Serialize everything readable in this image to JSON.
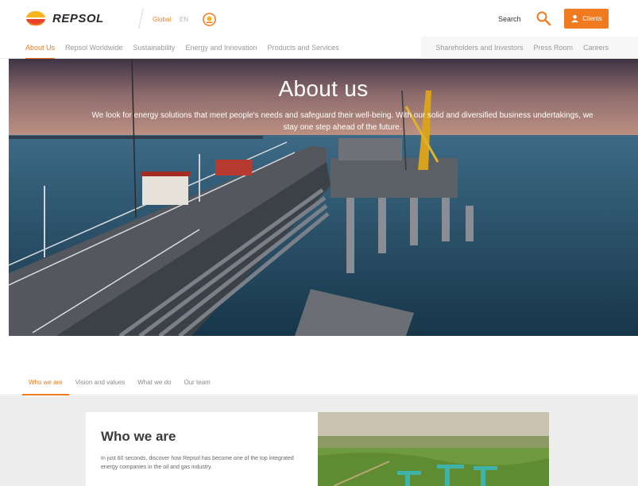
{
  "header": {
    "brand": "REPSOL",
    "lang_global": "Global",
    "lang_en": "EN",
    "search_label": "Search",
    "clients_label": "Clients"
  },
  "nav": {
    "left": [
      "About Us",
      "Repsol Worldwide",
      "Sustainability",
      "Energy and Innovation",
      "Products and Services"
    ],
    "right": [
      "Shareholders and Investors",
      "Press Room",
      "Careers"
    ],
    "active": "About Us"
  },
  "hero": {
    "title": "About us",
    "subtitle": "We look for energy solutions that meet people's needs and safeguard their well-being. With our solid and diversified business undertakings, we stay one step ahead of the future."
  },
  "subnav": {
    "items": [
      "Who we are",
      "Vision and values",
      "What we do",
      "Our team"
    ],
    "active": "Who we are"
  },
  "card": {
    "title": "Who we are",
    "text": "In just 60 seconds, discover how Repsol has become one of the top integrated energy companies in the oil and gas industry."
  },
  "colors": {
    "accent": "#f07a1f",
    "brand_red": "#e8412a",
    "brand_yellow": "#f7b51e"
  },
  "icons": [
    "repsol-logo-icon",
    "sun-badge-icon",
    "search-icon",
    "clients-icon"
  ]
}
